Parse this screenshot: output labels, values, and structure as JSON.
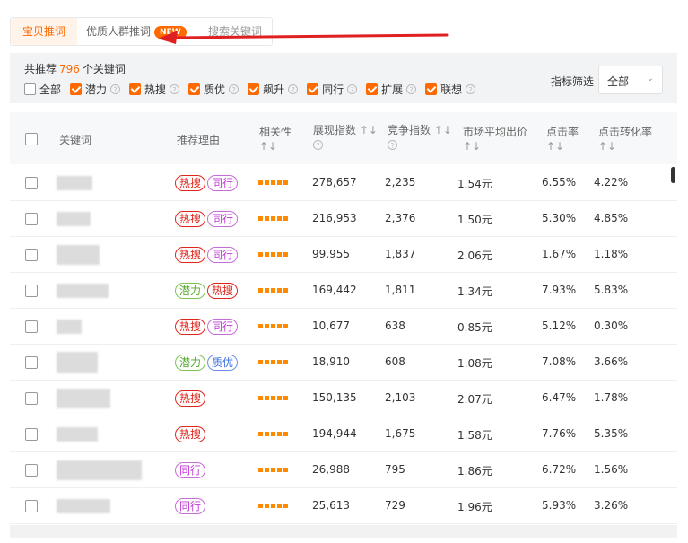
{
  "tabs": {
    "active": "宝贝推词",
    "second": "优质人群推词",
    "badge": "NEW",
    "third": "搜索关键词"
  },
  "filter": {
    "total_prefix": "共推荐",
    "total_count": "796",
    "total_suffix": "个关键词",
    "all_label": "全部",
    "options": [
      {
        "label": "潜力",
        "checked": true
      },
      {
        "label": "热搜",
        "checked": true
      },
      {
        "label": "质优",
        "checked": true
      },
      {
        "label": "飙升",
        "checked": true
      },
      {
        "label": "同行",
        "checked": true
      },
      {
        "label": "扩展",
        "checked": true
      },
      {
        "label": "联想",
        "checked": true
      }
    ],
    "indicator_label": "指标筛选",
    "indicator_value": "全部"
  },
  "table": {
    "headers": {
      "keyword": "关键词",
      "reason": "推荐理由",
      "relevance": "相关性",
      "impressions": "展现指数",
      "competition": "竞争指数",
      "avg_bid": "市场平均出价",
      "ctr": "点击率",
      "cvr": "点击转化率",
      "sort_symbol": "↑↓"
    },
    "rows": [
      {
        "tags": [
          "热搜",
          "同行"
        ],
        "impressions": "278,657",
        "competition": "2,235",
        "avg_bid": "1.54元",
        "ctr": "6.55%",
        "cvr": "4.22%"
      },
      {
        "tags": [
          "热搜",
          "同行"
        ],
        "impressions": "216,953",
        "competition": "2,376",
        "avg_bid": "1.50元",
        "ctr": "5.30%",
        "cvr": "4.85%"
      },
      {
        "tags": [
          "热搜",
          "同行"
        ],
        "impressions": "99,955",
        "competition": "1,837",
        "avg_bid": "2.06元",
        "ctr": "1.67%",
        "cvr": "1.18%"
      },
      {
        "tags": [
          "潜力",
          "热搜"
        ],
        "impressions": "169,442",
        "competition": "1,811",
        "avg_bid": "1.34元",
        "ctr": "7.93%",
        "cvr": "5.83%"
      },
      {
        "tags": [
          "热搜",
          "同行"
        ],
        "impressions": "10,677",
        "competition": "638",
        "avg_bid": "0.85元",
        "ctr": "5.12%",
        "cvr": "0.30%"
      },
      {
        "tags": [
          "潜力",
          "质优"
        ],
        "impressions": "18,910",
        "competition": "608",
        "avg_bid": "1.08元",
        "ctr": "7.08%",
        "cvr": "3.66%"
      },
      {
        "tags": [
          "热搜"
        ],
        "impressions": "150,135",
        "competition": "2,103",
        "avg_bid": "2.07元",
        "ctr": "6.47%",
        "cvr": "1.78%"
      },
      {
        "tags": [
          "热搜"
        ],
        "impressions": "194,944",
        "competition": "1,675",
        "avg_bid": "1.58元",
        "ctr": "7.76%",
        "cvr": "5.35%"
      },
      {
        "tags": [
          "同行"
        ],
        "impressions": "26,988",
        "competition": "795",
        "avg_bid": "1.86元",
        "ctr": "6.72%",
        "cvr": "1.56%"
      },
      {
        "tags": [
          "同行"
        ],
        "impressions": "25,613",
        "competition": "729",
        "avg_bid": "1.96元",
        "ctr": "5.93%",
        "cvr": "3.26%"
      }
    ]
  },
  "colors": {
    "accent": "#ff6a00",
    "annotation_arrow": "#e02020",
    "tag_hot": "#e1251b",
    "tag_peer": "#c039d6",
    "tag_potential": "#52a82a",
    "tag_quality": "#3a6de0",
    "relevance_dots": "#ff8a00"
  },
  "icons": {
    "help": "question-circle-icon",
    "dropdown": "chevron-down-icon",
    "arrow": "red-arrow-annotation"
  }
}
